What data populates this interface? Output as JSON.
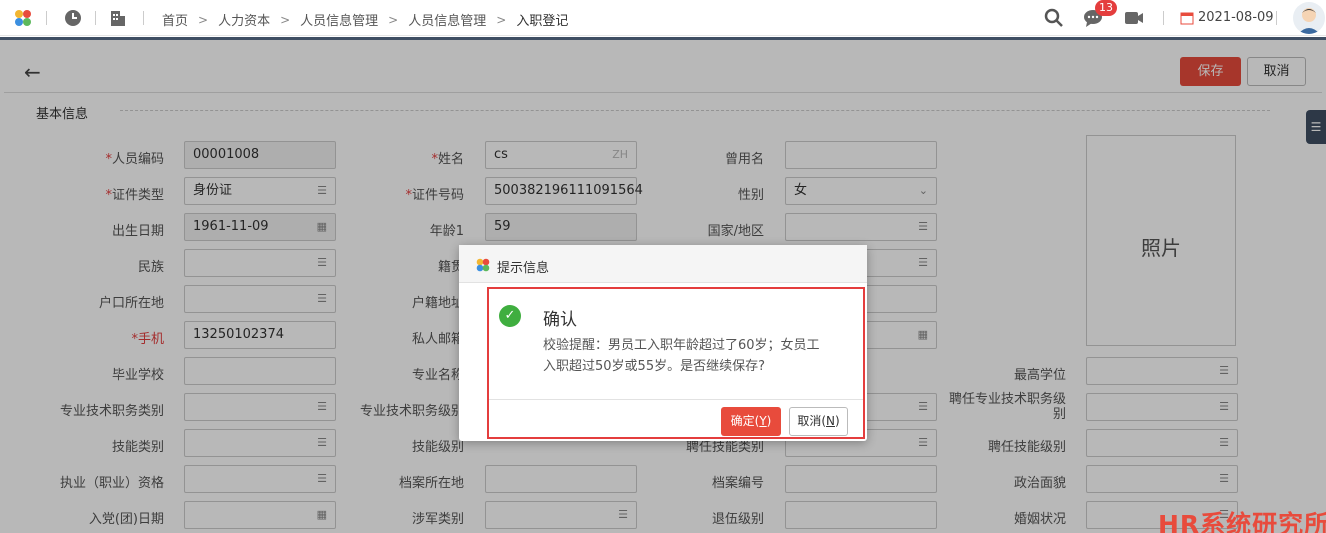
{
  "header": {
    "breadcrumb": [
      "首页",
      "人力资本",
      "人员信息管理",
      "人员信息管理",
      "入职登记"
    ],
    "badge_count": "13",
    "date": "2021-08-09",
    "icons": [
      "app-logo-icon",
      "clock-icon",
      "building-icon",
      "search-icon",
      "chat-icon",
      "video-icon",
      "calendar-icon"
    ]
  },
  "toolbar": {
    "save_label": "保存",
    "cancel_label": "取消",
    "back_icon": "arrow-left-icon"
  },
  "section": {
    "title": "基本信息"
  },
  "photo_label": "照片",
  "form": {
    "emp_code": {
      "label": "人员编码",
      "value": "00001008"
    },
    "name": {
      "label": "姓名",
      "value": "cs",
      "suffix": "ZH"
    },
    "former_name": {
      "label": "曾用名",
      "value": ""
    },
    "id_type": {
      "label": "证件类型",
      "value": "身份证"
    },
    "id_number": {
      "label": "证件号码",
      "value": "500382196111091564"
    },
    "gender": {
      "label": "性别",
      "value": "女"
    },
    "birth_date": {
      "label": "出生日期",
      "value": "1961-11-09"
    },
    "age": {
      "label": "年龄1",
      "value": "59"
    },
    "country": {
      "label": "国家/地区",
      "value": ""
    },
    "ethnicity": {
      "label": "民族",
      "value": ""
    },
    "native_place": {
      "label": "籍贯",
      "value": ""
    },
    "hukou_place": {
      "label": "户口所在地",
      "value": ""
    },
    "hukou_address": {
      "label": "户籍地址",
      "value": ""
    },
    "mobile": {
      "label": "手机",
      "value": "13250102374"
    },
    "private_email": {
      "label": "私人邮箱",
      "value": ""
    },
    "school": {
      "label": "毕业学校",
      "value": ""
    },
    "major": {
      "label": "专业名称",
      "value": ""
    },
    "degree": {
      "label": "最高学位",
      "value": ""
    },
    "tech_title_type": {
      "label": "专业技术职务类别",
      "value": ""
    },
    "tech_title_level": {
      "label": "专业技术职务级别",
      "value": ""
    },
    "appointed_tech_level": {
      "label": "聘任专业技术职务级别",
      "value": ""
    },
    "skill_type": {
      "label": "技能类别",
      "value": ""
    },
    "skill_level": {
      "label": "技能级别",
      "value": ""
    },
    "appointed_skill_type": {
      "label": "聘任技能类别",
      "value": ""
    },
    "appointed_skill_level": {
      "label": "聘任技能级别",
      "value": ""
    },
    "qualification": {
      "label": "执业（职业）资格",
      "value": ""
    },
    "archive_location": {
      "label": "档案所在地",
      "value": ""
    },
    "archive_no": {
      "label": "档案编号",
      "value": ""
    },
    "political": {
      "label": "政治面貌",
      "value": ""
    },
    "party_date": {
      "label": "入党(团)日期",
      "value": ""
    },
    "military_type": {
      "label": "涉军类别",
      "value": ""
    },
    "retired_level": {
      "label": "退伍级别",
      "value": ""
    },
    "marital": {
      "label": "婚姻状况",
      "value": ""
    }
  },
  "dialog": {
    "title": "提示信息",
    "heading": "确认",
    "message": "校验提醒：男员工入职年龄超过了60岁；女员工入职超过50岁或55岁。是否继续保存?",
    "ok_label": "确定",
    "ok_key": "Y",
    "cancel_label": "取消",
    "cancel_key": "N"
  },
  "watermark": "HR系统研究所",
  "colors": {
    "accent": "#e84b3c",
    "header_dark": "#3f4e63",
    "success": "#3fae3f",
    "required": "#e43d3d"
  }
}
